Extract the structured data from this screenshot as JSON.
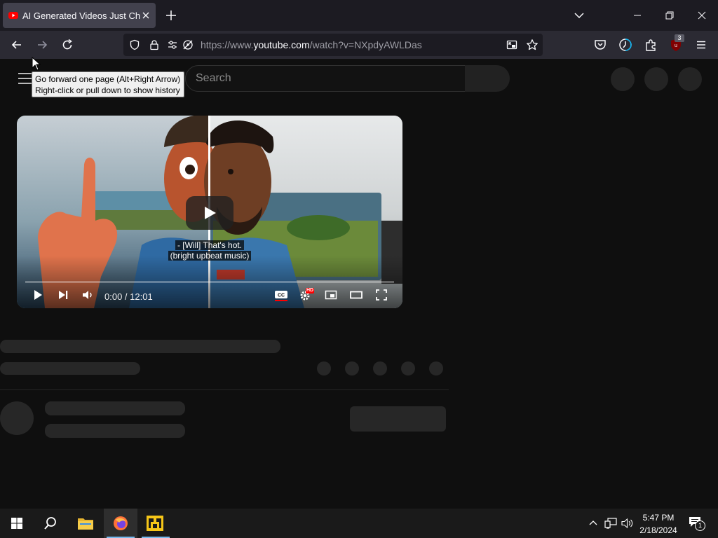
{
  "browser": {
    "tab_title": "AI Generated Videos Just Changed Forever",
    "url_prefix": "https://www.",
    "url_domain": "youtube.com",
    "url_path": "/watch?v=NXpdyAWLDas",
    "extension_badge": "3",
    "tooltip_line1": "Go forward one page (Alt+Right Arrow)",
    "tooltip_line2": "Right-click or pull down to show history"
  },
  "youtube": {
    "search_placeholder": "Search",
    "video": {
      "caption_line1": "- [Will] That's hot.",
      "caption_line2": "(bright upbeat music)",
      "time": "0:00 / 12:01",
      "quality_badge": "HD",
      "progress": 0.0
    }
  },
  "taskbar": {
    "time": "5:47 PM",
    "date": "2/18/2024",
    "notification_count": "1"
  },
  "colors": {
    "accent_red": "#ff0000",
    "tab_bg": "#42414d",
    "page_bg": "#0f0f0f"
  }
}
